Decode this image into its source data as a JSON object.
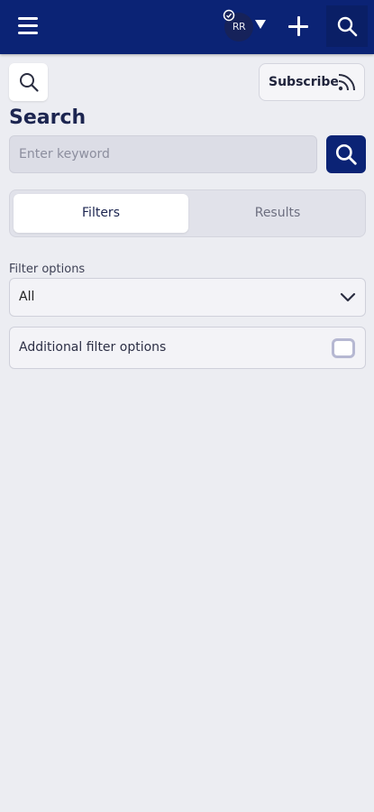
{
  "topbar": {
    "avatar_initials": "RR",
    "icons": [
      "hamburger-menu-icon",
      "check-circle-icon",
      "caret-down-icon",
      "plus-icon",
      "search-icon"
    ],
    "bar_color": "#0b2375"
  },
  "header": {
    "subscribe_label": "Subscribe",
    "subscribe_icon": "rss-feed-icon"
  },
  "search": {
    "title": "Search",
    "placeholder": "Enter keyword",
    "value": ""
  },
  "tabs": [
    {
      "label": "Filters",
      "active": true
    },
    {
      "label": "Results",
      "active": false
    }
  ],
  "filters": {
    "options_label": "Filter options",
    "selected_option": "All",
    "additional_label": "Additional filter options",
    "additional_enabled": false
  }
}
